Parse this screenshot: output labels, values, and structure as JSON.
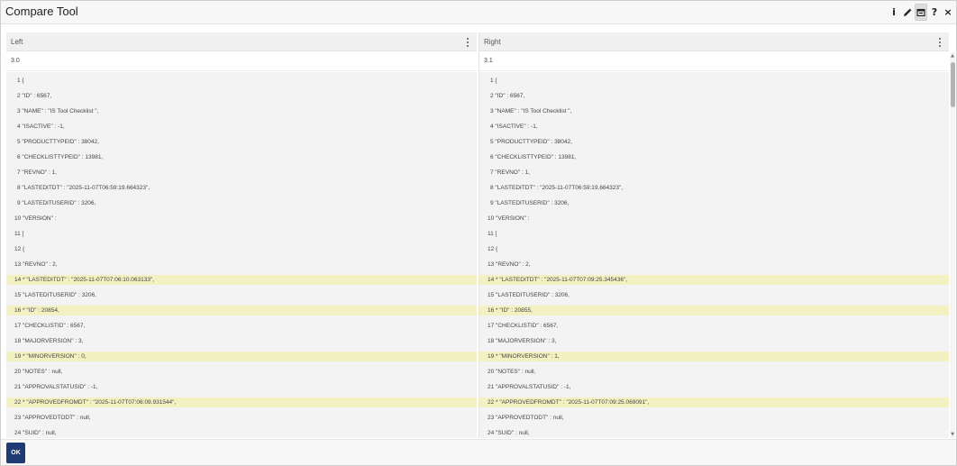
{
  "window": {
    "title": "Compare Tool",
    "actions": [
      {
        "name": "info-icon",
        "glyph": "i"
      },
      {
        "name": "pencil-icon",
        "glyph": "pencil"
      },
      {
        "name": "window-icon",
        "glyph": "window"
      },
      {
        "name": "help-icon",
        "glyph": "?"
      },
      {
        "name": "close-icon",
        "glyph": "×"
      }
    ]
  },
  "colors": {
    "diff_highlight": "#f3f1c1",
    "ok_button": "#1f3b73",
    "body_bg": "#f3f3f3"
  },
  "left": {
    "header": "Left",
    "version": "3.0",
    "lines": [
      {
        "text": "1 {",
        "diff": false
      },
      {
        "text": "2 \"ID\" : 6567,",
        "diff": false
      },
      {
        "text": "3 \"NAME\" : \"IS Tool Checklist \",",
        "diff": false
      },
      {
        "text": "4 \"ISACTIVE\" : -1,",
        "diff": false
      },
      {
        "text": "5 \"PRODUCTTYPEID\" : 38042,",
        "diff": false
      },
      {
        "text": "6 \"CHECKLISTTYPEID\" : 13981,",
        "diff": false
      },
      {
        "text": "7 \"REVNO\" : 1,",
        "diff": false
      },
      {
        "text": "8 \"LASTEDITDT\" : \"2025-11-07T06:59:19.664323\",",
        "diff": false
      },
      {
        "text": "9 \"LASTEDITUSERID\" : 3206,",
        "diff": false
      },
      {
        "text": "10 \"VERSION\" :",
        "diff": false
      },
      {
        "text": "11 [",
        "diff": false
      },
      {
        "text": "12 {",
        "diff": false
      },
      {
        "text": "13 \"REVNO\" : 2,",
        "diff": false
      },
      {
        "text": "14 * \"LASTEDITDT\" : \"2025-11-07T07:06:10.063133\",",
        "diff": true
      },
      {
        "text": "15 \"LASTEDITUSERID\" : 3206,",
        "diff": false
      },
      {
        "text": "16 * \"ID\" : 20854,",
        "diff": true
      },
      {
        "text": "17 \"CHECKLISTID\" : 6567,",
        "diff": false
      },
      {
        "text": "18 \"MAJORVERSION\" : 3,",
        "diff": false
      },
      {
        "text": "19 * \"MINORVERSION\" : 0,",
        "diff": true
      },
      {
        "text": "20 \"NOTES\" : null,",
        "diff": false
      },
      {
        "text": "21 \"APPROVALSTATUSID\" : -1,",
        "diff": false
      },
      {
        "text": "22 * \"APPROVEDFROMDT\" : \"2025-11-07T07:06:09.931544\",",
        "diff": true
      },
      {
        "text": "23 \"APPROVEDTODT\" : null,",
        "diff": false
      },
      {
        "text": "24 \"SUID\" : null,",
        "diff": false
      }
    ]
  },
  "right": {
    "header": "Right",
    "version": "3.1",
    "lines": [
      {
        "text": "1 {",
        "diff": false
      },
      {
        "text": "2 \"ID\" : 6567,",
        "diff": false
      },
      {
        "text": "3 \"NAME\" : \"IS Tool Checklist \",",
        "diff": false
      },
      {
        "text": "4 \"ISACTIVE\" : -1,",
        "diff": false
      },
      {
        "text": "5 \"PRODUCTTYPEID\" : 38042,",
        "diff": false
      },
      {
        "text": "6 \"CHECKLISTTYPEID\" : 13981,",
        "diff": false
      },
      {
        "text": "7 \"REVNO\" : 1,",
        "diff": false
      },
      {
        "text": "8 \"LASTEDITDT\" : \"2025-11-07T06:59:19.664323\",",
        "diff": false
      },
      {
        "text": "9 \"LASTEDITUSERID\" : 3206,",
        "diff": false
      },
      {
        "text": "10 \"VERSION\" :",
        "diff": false
      },
      {
        "text": "11 [",
        "diff": false
      },
      {
        "text": "12 {",
        "diff": false
      },
      {
        "text": "13 \"REVNO\" : 2,",
        "diff": false
      },
      {
        "text": "14 * \"LASTEDITDT\" : \"2025-11-07T07:09:25.345436\",",
        "diff": true
      },
      {
        "text": "15 \"LASTEDITUSERID\" : 3206,",
        "diff": false
      },
      {
        "text": "16 * \"ID\" : 20855,",
        "diff": true
      },
      {
        "text": "17 \"CHECKLISTID\" : 6567,",
        "diff": false
      },
      {
        "text": "18 \"MAJORVERSION\" : 3,",
        "diff": false
      },
      {
        "text": "19 * \"MINORVERSION\" : 1,",
        "diff": true
      },
      {
        "text": "20 \"NOTES\" : null,",
        "diff": false
      },
      {
        "text": "21 \"APPROVALSTATUSID\" : -1,",
        "diff": false
      },
      {
        "text": "22 * \"APPROVEDFROMDT\" : \"2025-11-07T07:09:25.069091\",",
        "diff": true
      },
      {
        "text": "23 \"APPROVEDTODT\" : null,",
        "diff": false
      },
      {
        "text": "24 \"SUID\" : null,",
        "diff": false
      }
    ]
  },
  "footer": {
    "ok_label": "OK"
  }
}
